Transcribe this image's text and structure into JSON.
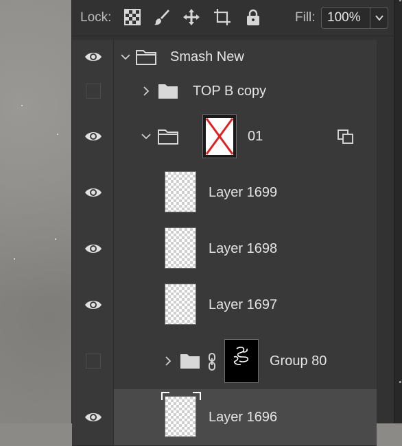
{
  "toolbar": {
    "lock_label": "Lock:",
    "lock_icons": [
      "lock-transparent-pixels-icon",
      "lock-image-pixels-icon",
      "lock-position-icon",
      "lock-artboard-icon",
      "lock-all-icon"
    ],
    "fill_label": "Fill:",
    "fill_value": "100%"
  },
  "layers": [
    {
      "name": "Smash New",
      "type": "group",
      "visible": true,
      "expanded": true
    },
    {
      "name": "TOP B copy",
      "type": "group",
      "visible": false,
      "expanded": false
    },
    {
      "name": "01",
      "type": "group",
      "visible": true,
      "expanded": true,
      "has_mask": true
    },
    {
      "name": "Layer 1699",
      "type": "layer",
      "visible": true
    },
    {
      "name": "Layer 1698",
      "type": "layer",
      "visible": true
    },
    {
      "name": "Layer 1697",
      "type": "layer",
      "visible": true
    },
    {
      "name": "Group 80",
      "type": "group",
      "visible": false,
      "expanded": false,
      "linked_mask": true
    },
    {
      "name": "Layer 1696",
      "type": "layer",
      "visible": true,
      "selected": true
    }
  ],
  "colors": {
    "panel_bg": "#323232",
    "row_bg": "#393939",
    "selected_row_bg": "#4a4a4a",
    "text": "#e4e4e4",
    "mask_x": "#e02020"
  }
}
